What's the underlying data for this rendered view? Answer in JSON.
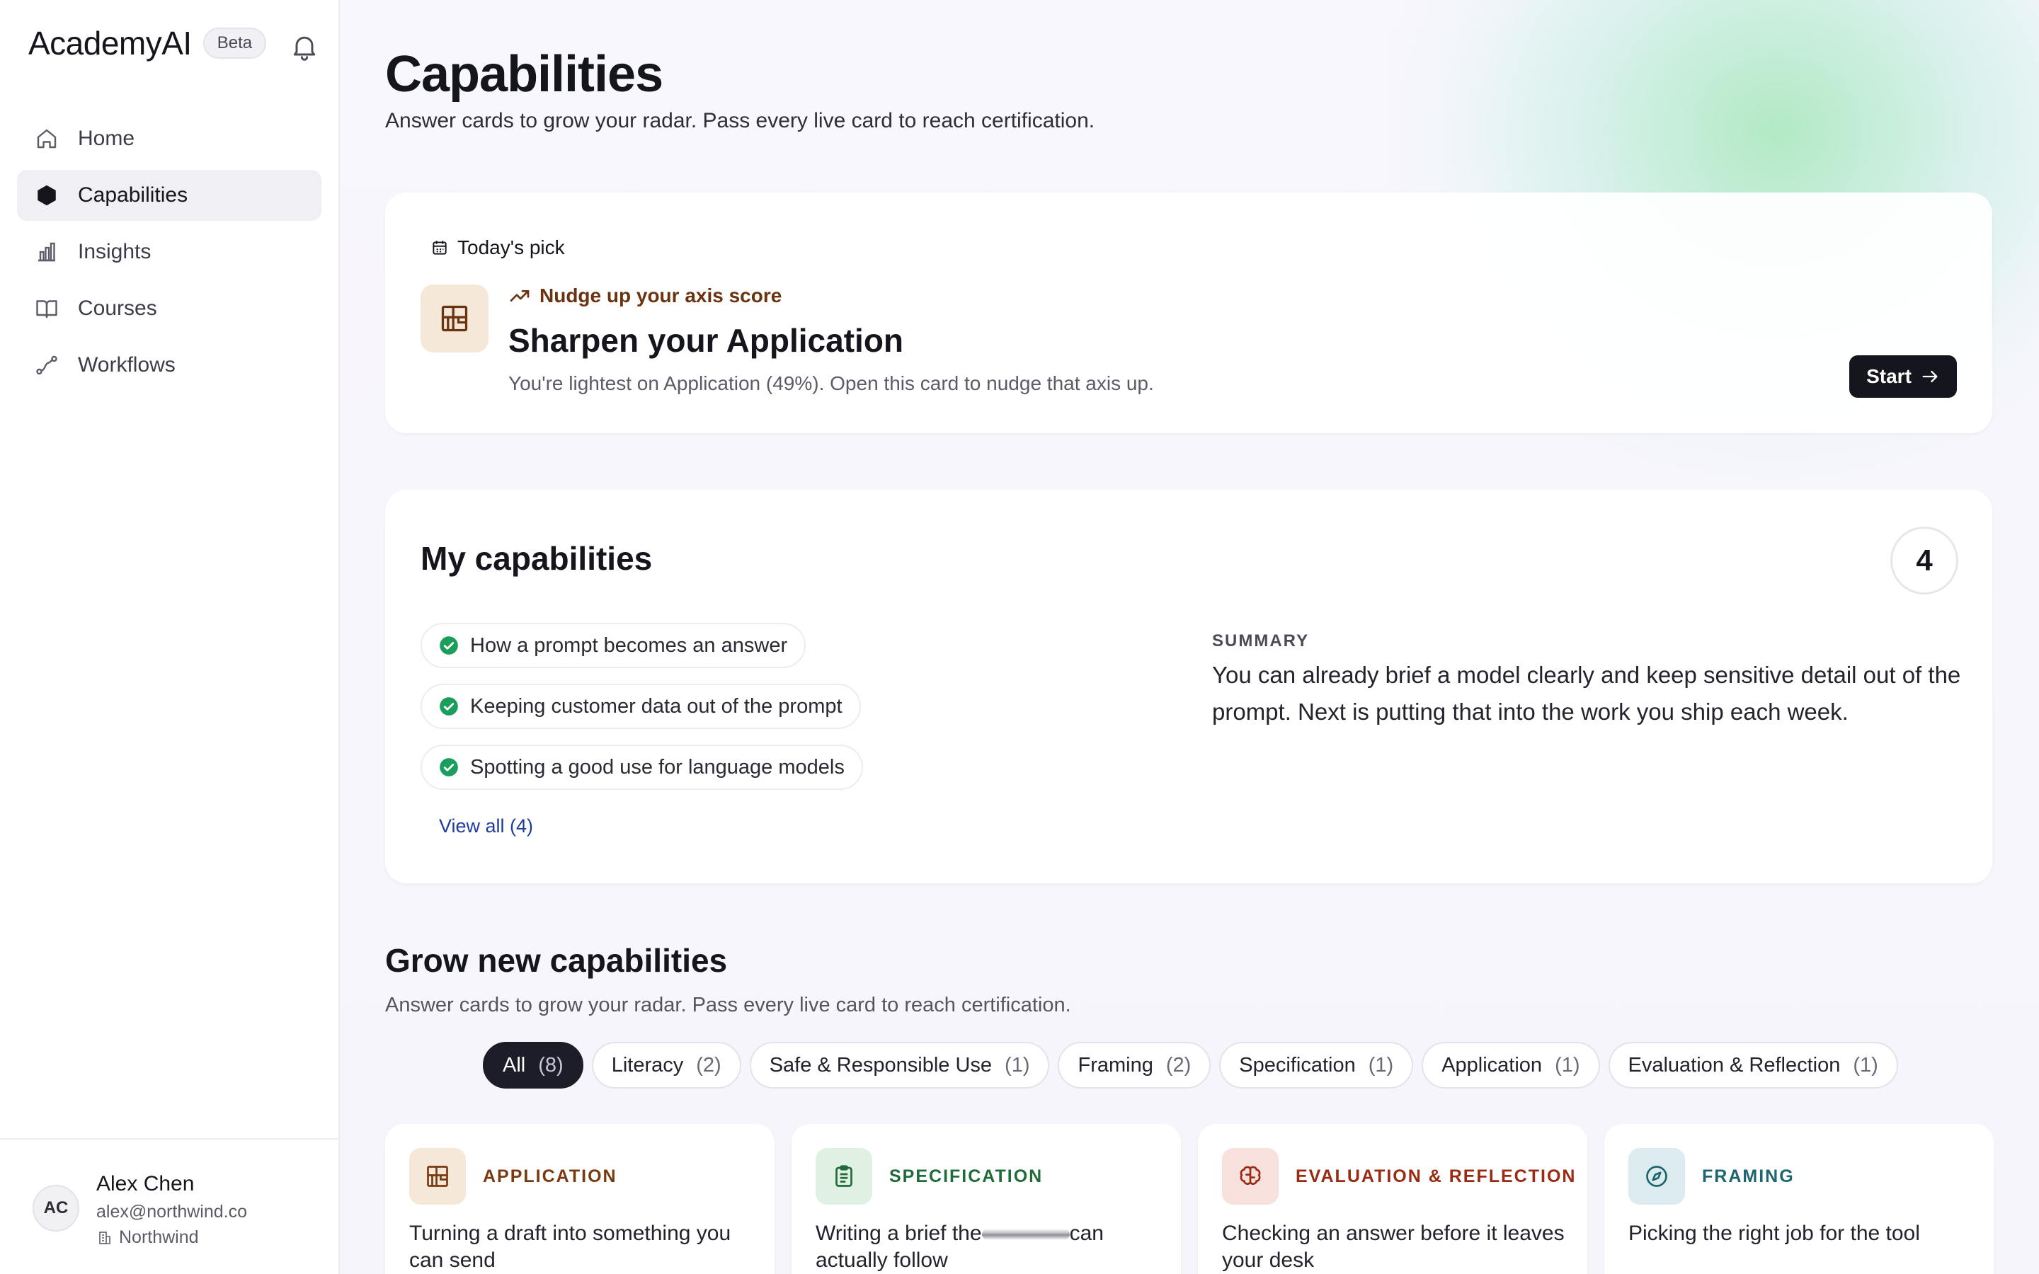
{
  "app": {
    "name": "AcademyAI",
    "badge": "Beta"
  },
  "sidebar": {
    "items": [
      {
        "label": "Home",
        "icon": "home-icon",
        "active": false
      },
      {
        "label": "Capabilities",
        "icon": "hexagon-icon",
        "active": true
      },
      {
        "label": "Insights",
        "icon": "bar-chart-icon",
        "active": false
      },
      {
        "label": "Courses",
        "icon": "book-icon",
        "active": false
      },
      {
        "label": "Workflows",
        "icon": "workflow-icon",
        "active": false
      }
    ]
  },
  "user": {
    "initials": "AC",
    "name": "Alex Chen",
    "email": "alex@northwind.co",
    "org": "Northwind"
  },
  "page": {
    "title": "Capabilities",
    "subtitle": "Answer cards to grow your radar. Pass every live card to reach certification."
  },
  "today": {
    "label": "Today's pick",
    "nudge": "Nudge up your axis score",
    "title": "Sharpen your Application",
    "description": "You're lightest on Application (49%). Open this card to nudge that axis up.",
    "button": "Start"
  },
  "my_capabilities": {
    "title": "My capabilities",
    "count": "4",
    "items": [
      "How a prompt becomes an answer",
      "Keeping customer data out of the prompt",
      "Spotting a good use for language models"
    ],
    "view_all": "View all (4)",
    "summary_label": "SUMMARY",
    "summary": "You can already brief a model clearly and keep sensitive detail out of the prompt. Next is putting that into the work you ship each week."
  },
  "grow": {
    "title": "Grow new capabilities",
    "subtitle": "Answer cards to grow your radar. Pass every live card to reach certification.",
    "filters": [
      {
        "label": "All",
        "count": "(8)",
        "active": true
      },
      {
        "label": "Literacy",
        "count": "(2)",
        "active": false
      },
      {
        "label": "Safe & Responsible Use",
        "count": "(1)",
        "active": false
      },
      {
        "label": "Framing",
        "count": "(2)",
        "active": false
      },
      {
        "label": "Specification",
        "count": "(1)",
        "active": false
      },
      {
        "label": "Application",
        "count": "(1)",
        "active": false
      },
      {
        "label": "Evaluation & Reflection",
        "count": "(1)",
        "active": false
      }
    ],
    "cards": [
      {
        "category": "APPLICATION",
        "text": "Turning a draft into something you can send",
        "color": "#7a3a10",
        "bg": "#f6e8d9"
      },
      {
        "category": "SPECIFICATION",
        "text_before": "Writing a brief the",
        "text_after": "can actually follow",
        "color": "#1f6b3a",
        "bg": "#e0f1e4"
      },
      {
        "category": "EVALUATION & REFLECTION",
        "text": "Checking an answer before it leaves your desk",
        "color": "#9a2a12",
        "bg": "#f8e1dc"
      },
      {
        "category": "FRAMING",
        "text": "Picking the right job for the tool",
        "color": "#1d6670",
        "bg": "#dcecee"
      }
    ]
  },
  "colors": {
    "accent_dark": "#15151d",
    "check_green": "#1a9e5c",
    "link_blue": "#1f3d9e"
  }
}
